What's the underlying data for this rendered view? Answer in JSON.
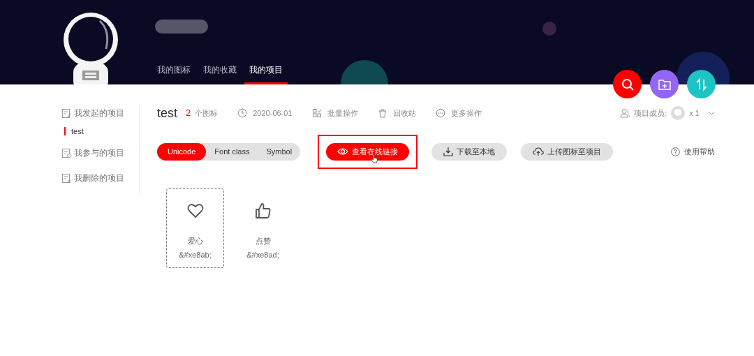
{
  "header": {
    "tabs": [
      {
        "label": "我的图标",
        "selected": false
      },
      {
        "label": "我的收藏",
        "selected": false
      },
      {
        "label": "我的项目",
        "selected": true
      }
    ]
  },
  "fab_buttons": [
    {
      "kind": "search",
      "color": "#ff0000"
    },
    {
      "kind": "add-folder",
      "color": "#9466f5"
    },
    {
      "kind": "sort",
      "color": "#1ec3c3"
    }
  ],
  "sidebar": {
    "groups": [
      {
        "label": "我发起的项目",
        "kind": "started",
        "children": [
          {
            "label": "test",
            "selected": true
          }
        ]
      },
      {
        "label": "我参与的项目",
        "kind": "joined"
      },
      {
        "label": "我删除的项目",
        "kind": "deleted"
      }
    ]
  },
  "project": {
    "title": "test",
    "icon_count": "2",
    "icon_count_label": "个图标",
    "meta": [
      {
        "kind": "date",
        "label": "2020-06-01"
      },
      {
        "kind": "batch",
        "label": "批量操作"
      },
      {
        "kind": "trash",
        "label": "回收站"
      },
      {
        "kind": "more",
        "label": "更多操作"
      }
    ],
    "members": {
      "label": "项目成员:",
      "count": "x 1"
    }
  },
  "modes": [
    {
      "label": "Unicode",
      "selected": true
    },
    {
      "label": "Font class",
      "selected": false
    },
    {
      "label": "Symbol",
      "selected": false
    }
  ],
  "actions": [
    {
      "kind": "eye",
      "label": "查看在线链接",
      "primary": true,
      "highlighted": true
    },
    {
      "kind": "download",
      "label": "下载至本地",
      "primary": false,
      "highlighted": false
    },
    {
      "kind": "upload",
      "label": "上传图标至项目",
      "primary": false,
      "highlighted": false
    }
  ],
  "help": "使用帮助",
  "icons": [
    {
      "kind": "heart",
      "name": "爱心",
      "code": "&#xe8ab;",
      "selected": true
    },
    {
      "kind": "thumb",
      "name": "点赞",
      "code": "&#xe8ad;",
      "selected": false
    }
  ]
}
